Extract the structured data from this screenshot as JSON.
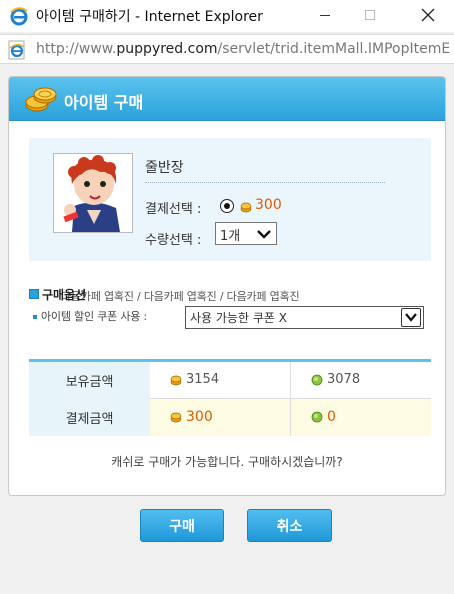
{
  "window": {
    "title": "아이템 구매하기 - Internet Explorer",
    "url_prefix": "http://www.",
    "url_domain": "puppyred.com",
    "url_path": "/servlet/trid.itemMall.IMPopItemEE?"
  },
  "popup": {
    "title": "아이템 구매",
    "item_name": "줄반장",
    "payment_label": "결제선택 :",
    "payment_price": "300",
    "quantity_label": "수량선택 :",
    "quantity_value": "1개",
    "options_title": "구매옵션",
    "options_ghost_text": "다음카페 엽혹진 / 다음카페 엽혹진 / 다음카페 엽혹진",
    "coupon_label": "아이템 할인 쿠폰 사용 :",
    "coupon_value": "사용 가능한 쿠폰 X",
    "balance": {
      "rows": [
        {
          "label": "보유금액",
          "gold": "3154",
          "green": "3078"
        },
        {
          "label": "결제금액",
          "gold": "300",
          "green": "0"
        }
      ]
    },
    "confirm_text": "캐쉬로 구매가 가능합니다. 구매하시겠습니까?",
    "buy_button": "구매",
    "cancel_button": "취소"
  },
  "colors": {
    "header_blue": "#2aa1dc",
    "price_orange": "#e05a00",
    "highlight_yellow": "#fdfbe1",
    "info_bg": "#eaf6fc"
  },
  "icons": [
    "ie-logo-icon",
    "gold-coin-icon",
    "green-coin-icon",
    "coins-stack-icon",
    "chevron-down-icon"
  ]
}
